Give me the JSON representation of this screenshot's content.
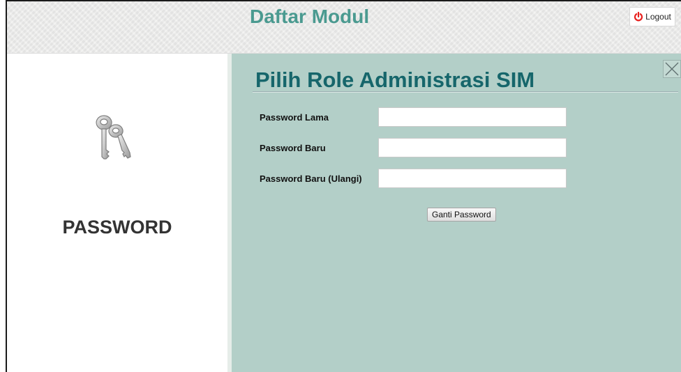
{
  "header": {
    "title": "Daftar Modul",
    "logout_label": "Logout",
    "logout_icon": "power-icon",
    "logout_icon_color": "#e8201e",
    "title_color": "#4a9a90"
  },
  "sidebar": {
    "icon": "keys-icon",
    "label": "PASSWORD"
  },
  "main": {
    "title": "Pilih Role Administrasi SIM",
    "title_color": "#16666b",
    "background_color": "#b3cfc8",
    "close_icon": "close-icon",
    "fields": [
      {
        "label": "Password Lama",
        "value": ""
      },
      {
        "label": "Password Baru",
        "value": ""
      },
      {
        "label": "Password Baru (Ulangi)",
        "value": ""
      }
    ],
    "submit_label": "Ganti Password"
  }
}
